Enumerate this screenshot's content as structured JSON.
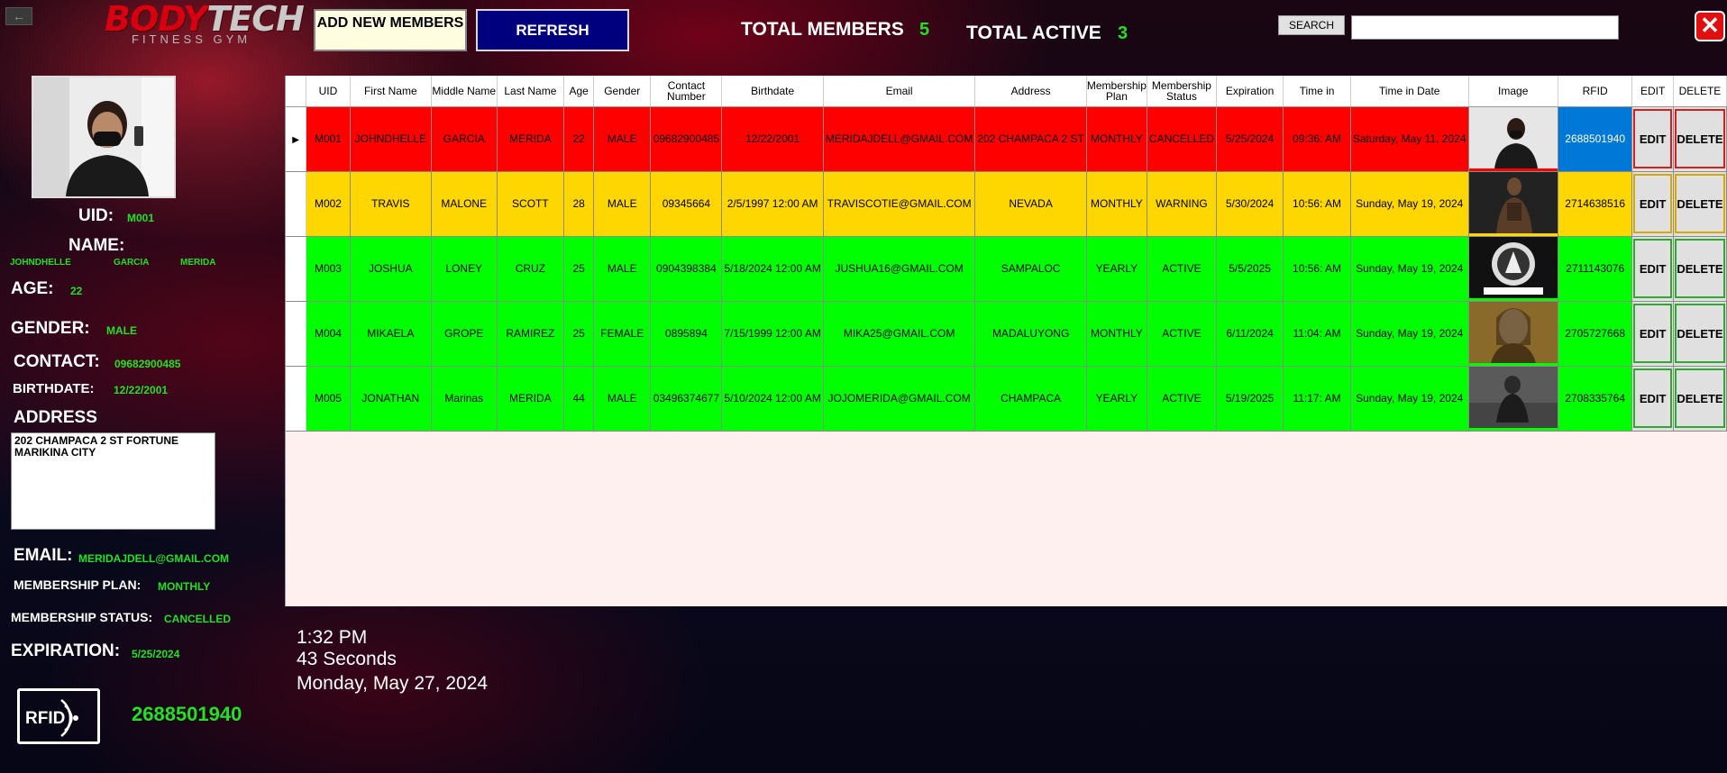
{
  "header": {
    "back_label": "←",
    "logo": {
      "part1": "BODY",
      "part2": "TECH",
      "sub": "FITNESS GYM"
    },
    "add_label": "ADD NEW MEMBERS",
    "refresh_label": "REFRESH",
    "total_members_label": "TOTAL MEMBERS",
    "total_members_value": "5",
    "total_active_label": "TOTAL ACTIVE",
    "total_active_value": "3",
    "search_label": "SEARCH",
    "search_value": "",
    "close_label": "✕"
  },
  "profile": {
    "uid_label": "UID:",
    "uid": "M001",
    "name_label": "NAME:",
    "first": "JOHNDHELLE",
    "middle": "GARCIA",
    "last": "MERIDA",
    "age_label": "AGE:",
    "age": "22",
    "gender_label": "GENDER:",
    "gender": "MALE",
    "contact_label": "CONTACT:",
    "contact": "09682900485",
    "birthdate_label": "BIRTHDATE:",
    "birthdate": "12/22/2001",
    "address_label": "ADDRESS",
    "address": "202 CHAMPACA 2 ST FORTUNE MARIKINA CITY",
    "email_label": "EMAIL:",
    "email": "MERIDAJDELL@GMAIL.COM",
    "plan_label": "MEMBERSHIP PLAN:",
    "plan": "MONTHLY",
    "status_label": "MEMBERSHIP STATUS:",
    "status": "CANCELLED",
    "expiration_label": "EXPIRATION:",
    "expiration": "5/25/2024",
    "rfid_icon_text": "RFID",
    "rfid": "2688501940"
  },
  "clock": {
    "time": "1:32 PM",
    "seconds": "43 Seconds",
    "date": "Monday, May 27, 2024"
  },
  "table": {
    "columns": [
      "UID",
      "First Name",
      "Middle Name",
      "Last Name",
      "Age",
      "Gender",
      "Contact Number",
      "Birthdate",
      "Email",
      "Address",
      "Membership Plan",
      "Membership Status",
      "Expiration",
      "Time in",
      "Time in Date",
      "Image",
      "RFID",
      "EDIT",
      "DELETE"
    ],
    "edit_label": "EDIT",
    "delete_label": "DELETE",
    "rows": [
      {
        "color": "#ff0000",
        "uid": "M001",
        "first": "JOHNDHELLE",
        "middle": "GARCIA",
        "last": "MERIDA",
        "age": "22",
        "gender": "MALE",
        "contact": "09682900485",
        "birthdate": "12/22/2001",
        "email": "MERIDAJDELL@GMAIL.COM",
        "address": "202 CHAMPACA 2 ST",
        "plan": "MONTHLY",
        "status": "CANCELLED",
        "expiration": "5/25/2024",
        "time_in": "09:36: AM",
        "time_in_date": "Saturday, May 11, 2024",
        "rfid": "2688501940",
        "image": "photo-selfie-icon"
      },
      {
        "color": "#ffd700",
        "uid": "M002",
        "first": "TRAVIS",
        "middle": "MALONE",
        "last": "SCOTT",
        "age": "28",
        "gender": "MALE",
        "contact": "09345664",
        "birthdate": "2/5/1997 12:00 AM",
        "email": "TRAVISCOTIE@GMAIL.COM",
        "address": "NEVADA",
        "plan": "MONTHLY",
        "status": "WARNING",
        "expiration": "5/30/2024",
        "time_in": "10:56: AM",
        "time_in_date": "Sunday, May 19, 2024",
        "rfid": "2714638516",
        "image": "photo-performer-icon"
      },
      {
        "color": "#00ff00",
        "uid": "M003",
        "first": "JOSHUA",
        "middle": "LONEY",
        "last": "CRUZ",
        "age": "25",
        "gender": "MALE",
        "contact": "0904398384",
        "birthdate": "5/18/2024 12:00 AM",
        "email": "JUSHUA16@GMAIL.COM",
        "address": "SAMPALOC",
        "plan": "YEARLY",
        "status": "ACTIVE",
        "expiration": "5/5/2025",
        "time_in": "10:56: AM",
        "time_in_date": "Sunday, May 19, 2024",
        "rfid": "2711143076",
        "image": "photo-carmelite-logo-icon"
      },
      {
        "color": "#00ff00",
        "uid": "M004",
        "first": "MIKAELA",
        "middle": "GROPE",
        "last": "RAMIREZ",
        "age": "25",
        "gender": "FEMALE",
        "contact": "0895894",
        "birthdate": "7/15/1999 12:00 AM",
        "email": "MIKA25@GMAIL.COM",
        "address": "MADALUYONG",
        "plan": "MONTHLY",
        "status": "ACTIVE",
        "expiration": "6/11/2024",
        "time_in": "11:04: AM",
        "time_in_date": "Sunday, May 19, 2024",
        "rfid": "2705727668",
        "image": "photo-portrait-icon"
      },
      {
        "color": "#00ff00",
        "uid": "M005",
        "first": "JONATHAN",
        "middle": "Marinas",
        "last": "MERIDA",
        "age": "44",
        "gender": "MALE",
        "contact": "03496374677",
        "birthdate": "5/10/2024 12:00 AM",
        "email": "JOJOMERIDA@GMAIL.COM",
        "address": "CHAMPACA",
        "plan": "YEARLY",
        "status": "ACTIVE",
        "expiration": "5/19/2025",
        "time_in": "11:17: AM",
        "time_in_date": "Sunday, May 19, 2024",
        "rfid": "2708335764",
        "image": "photo-man-sitting-icon"
      }
    ]
  }
}
